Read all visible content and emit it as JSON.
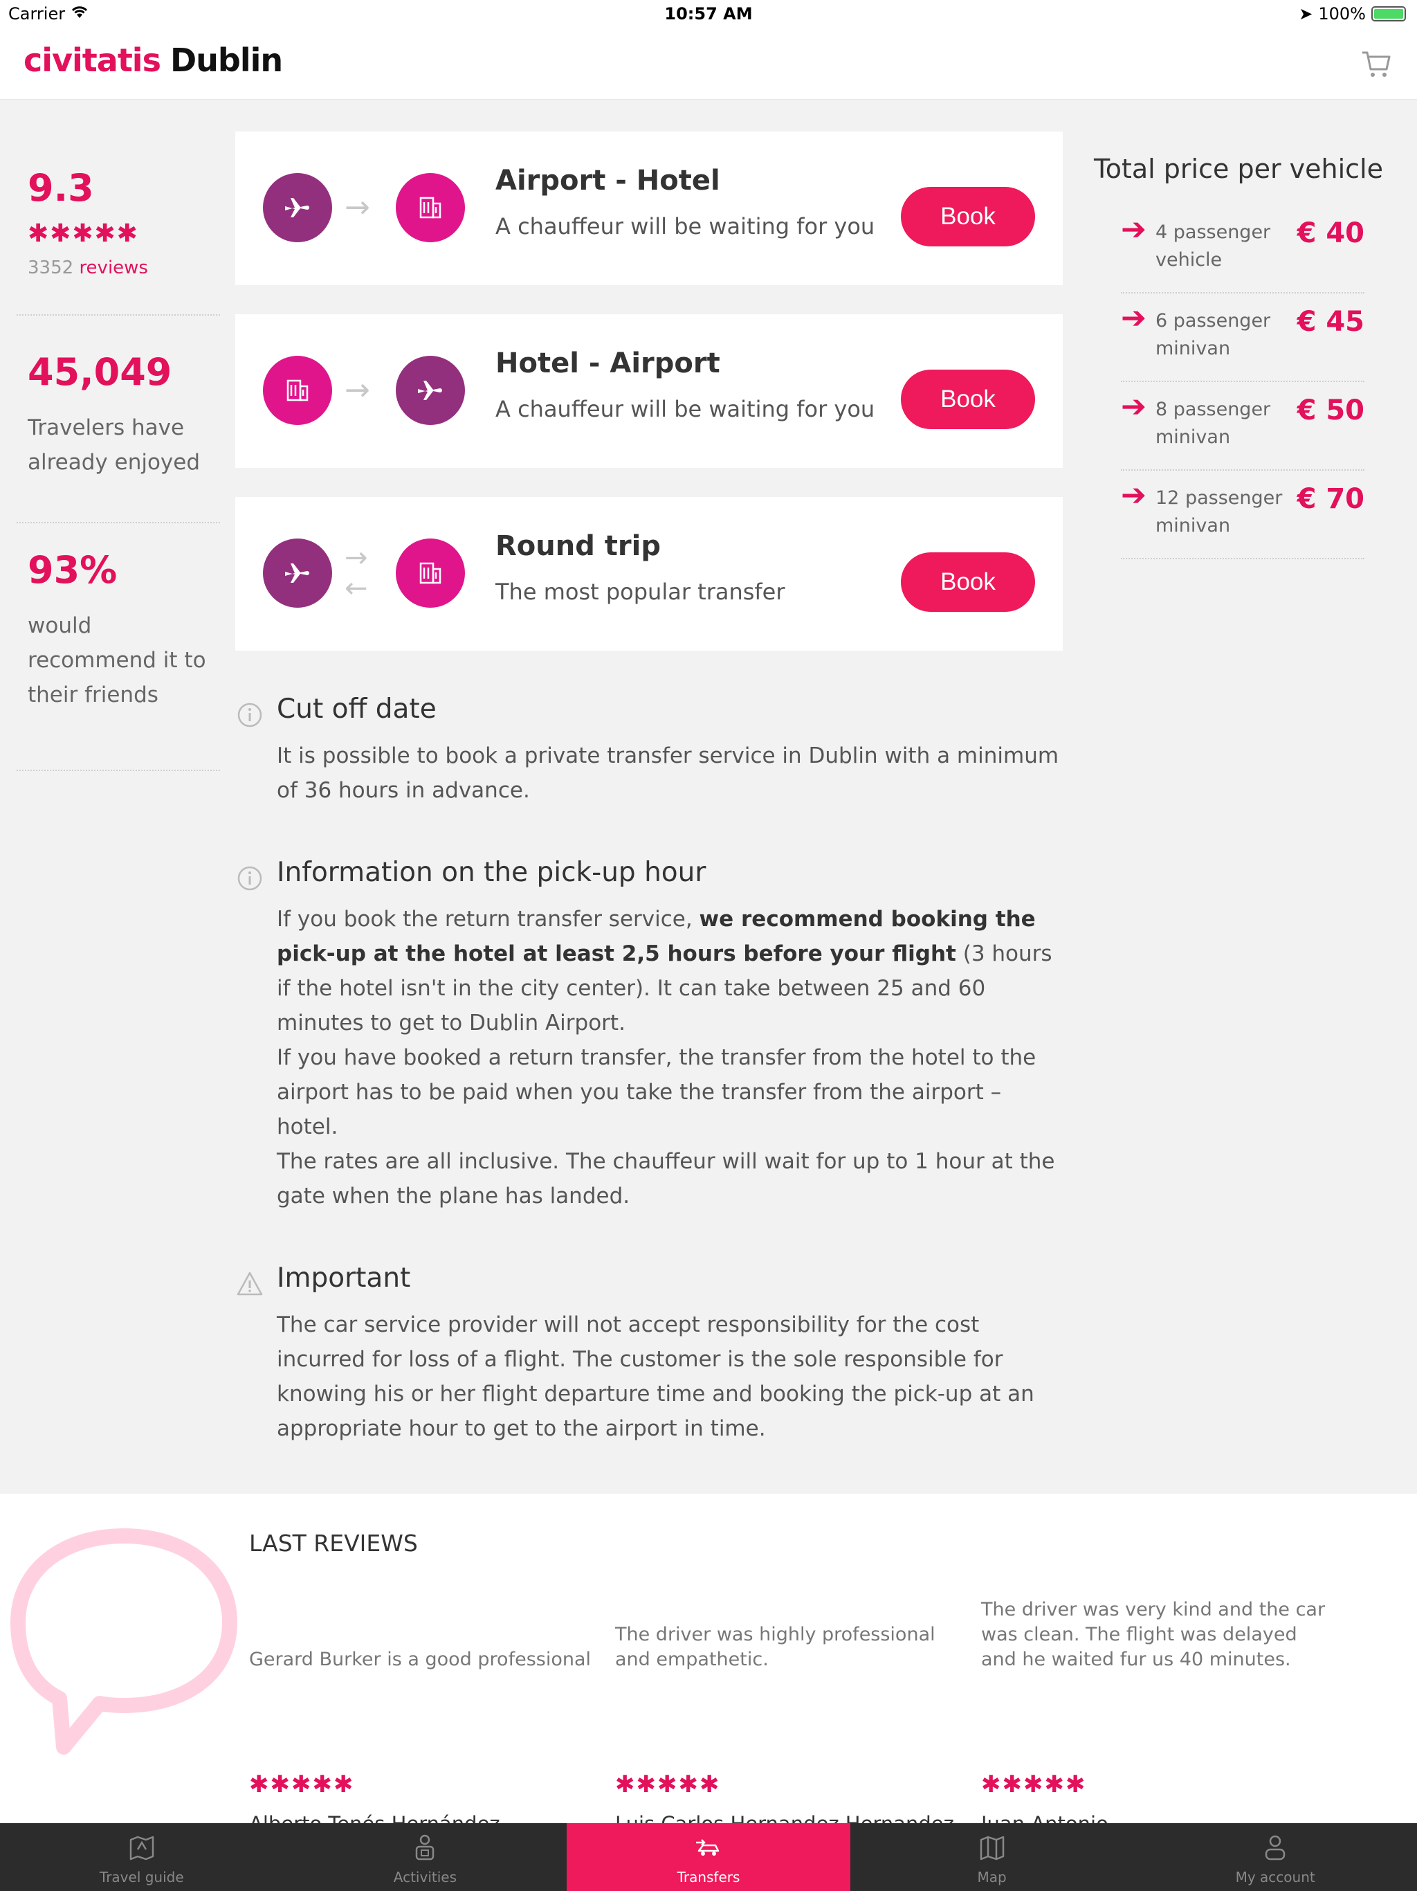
{
  "status_bar": {
    "carrier": "Carrier",
    "time": "10:57 AM",
    "battery": "100%"
  },
  "header": {
    "brand_main": "civitatis",
    "brand_city": "Dublin"
  },
  "stats": {
    "rating": "9.3",
    "stars": "✱✱✱✱✱",
    "review_count": "3352",
    "review_label": "reviews",
    "travelers": "45,049",
    "travelers_text": "Travelers have already enjoyed",
    "recommend": "93%",
    "recommend_text": "would recommend it to their friends"
  },
  "transfers": [
    {
      "title": "Airport - Hotel",
      "subtitle": "A chauffeur will be waiting for you",
      "book": "Book"
    },
    {
      "title": "Hotel - Airport",
      "subtitle": "A chauffeur will be waiting for you",
      "book": "Book"
    },
    {
      "title": "Round trip",
      "subtitle": "The most popular transfer",
      "book": "Book"
    }
  ],
  "prices": {
    "title": "Total price per vehicle",
    "rows": [
      {
        "vehicle": "4 passenger vehicle",
        "price": "€ 40"
      },
      {
        "vehicle": "6 passenger minivan",
        "price": "€ 45"
      },
      {
        "vehicle": "8 passenger minivan",
        "price": "€ 50"
      },
      {
        "vehicle": "12 passenger minivan",
        "price": "€ 70"
      }
    ]
  },
  "info": {
    "cutoff_title": "Cut off date",
    "cutoff_text": "It is possible to book a private transfer service in Dublin with a minimum of 36 hours in advance.",
    "pickup_title": "Information on the pick-up hour",
    "pickup_text_1a": "If you book the return transfer service, ",
    "pickup_text_1b": "we recommend booking the pick-up at the hotel at least 2,5 hours before your flight",
    "pickup_text_1c": " (3 hours if the hotel isn't in the city center). It can take between 25 and 60 minutes to get to Dublin Airport.",
    "pickup_text_2": "If you have booked a return transfer, the transfer from the hotel to the airport has to be paid when you take the transfer from the airport – hotel.",
    "pickup_text_3": "The rates are all inclusive. The chauffeur will wait for up to 1 hour at the gate when the plane has landed.",
    "important_title": "Important",
    "important_text": "The car service provider will not accept responsibility for the cost incurred for loss of a flight. The customer is the sole responsible for knowing his or her flight departure time and booking the pick-up at an appropriate hour to get to the airport in time."
  },
  "reviews": {
    "heading": "LAST REVIEWS",
    "items": [
      {
        "text": "Gerard Burker is a good professional",
        "stars": "✱✱✱✱✱",
        "author": "Alberto Tenés Hernández"
      },
      {
        "text": "The driver was highly professional and empathetic.",
        "stars": "✱✱✱✱✱",
        "author": "Luis Carlos Hernandez Hernandez"
      },
      {
        "text": "The driver was very kind and the car was clean. The flight was delayed and he waited fur us 40 minutes.",
        "stars": "✱✱✱✱✱",
        "author": "Juan Antonio"
      }
    ]
  },
  "tabs": [
    {
      "label": "Travel guide",
      "icon": "travel-guide-icon"
    },
    {
      "label": "Activities",
      "icon": "activities-icon"
    },
    {
      "label": "Transfers",
      "icon": "transfers-icon",
      "active": true
    },
    {
      "label": "Map",
      "icon": "map-icon"
    },
    {
      "label": "My account",
      "icon": "account-icon"
    }
  ],
  "colors": {
    "accent": "#ee1a5b",
    "brand": "#e3105b",
    "purple": "#93307e",
    "magenta": "#e0158c",
    "tab_bar": "#2c2c2c"
  }
}
